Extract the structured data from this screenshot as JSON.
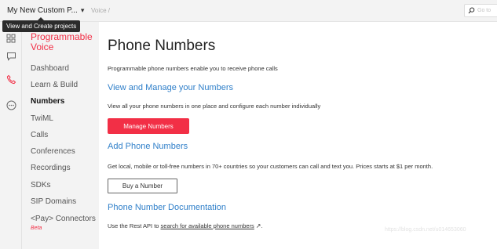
{
  "topbar": {
    "project_name": "My New Custom P...",
    "project_chevron": "▾",
    "breadcrumb": "Voice  /",
    "search_placeholder": "Go to"
  },
  "tooltip": "View and Create projects",
  "rail": [
    "grid-icon",
    "chat-icon",
    "phone-icon",
    "more-icon"
  ],
  "nav": {
    "title": "Programmable Voice",
    "items": [
      {
        "label": "Dashboard"
      },
      {
        "label": "Learn & Build"
      },
      {
        "label": "Numbers",
        "active": true
      },
      {
        "label": "TwiML"
      },
      {
        "label": "Calls"
      },
      {
        "label": "Conferences"
      },
      {
        "label": "Recordings"
      },
      {
        "label": "SDKs"
      },
      {
        "label": "SIP Domains"
      },
      {
        "label": "<Pay> Connectors"
      }
    ],
    "beta": "Beta"
  },
  "main": {
    "title": "Phone Numbers",
    "intro": "Programmable phone numbers enable you to receive phone calls",
    "manage_heading": "View and Manage your Numbers",
    "manage_text": "View all your phone numbers in one place and configure each number individually",
    "manage_button": "Manage Numbers",
    "add_heading": "Add Phone Numbers",
    "add_text": "Get local, mobile or toll-free numbers in 70+ countries so your customers can call and text you. Prices starts at $1 per month.",
    "buy_button": "Buy a Number",
    "docs_heading": "Phone Number Documentation",
    "docs_prefix": "Use the Rest API to ",
    "docs_link": "search for available phone numbers",
    "docs_ext": "↗",
    "docs_suffix": "."
  },
  "watermark": "https://blog.csdn.net/u014653060",
  "colors": {
    "accent": "#f22f46",
    "link_heading": "#2f7fc9",
    "sidebar_bg": "#f3f3f3"
  }
}
